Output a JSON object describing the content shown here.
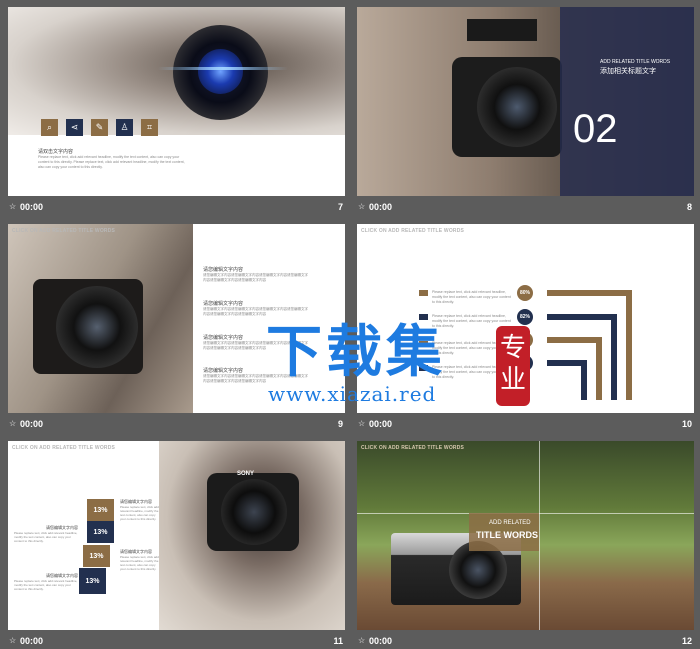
{
  "captions": [
    {
      "time": "00:00",
      "num": "7"
    },
    {
      "time": "00:00",
      "num": "8"
    },
    {
      "time": "00:00",
      "num": "9"
    },
    {
      "time": "00:00",
      "num": "10"
    },
    {
      "time": "00:00",
      "num": "11"
    },
    {
      "time": "00:00",
      "num": "12"
    }
  ],
  "star_icon": "☆",
  "slide7": {
    "heading": "请双击文字内容",
    "body": "Please replace text, click add relevant headline, modify the text content, also can copy your content to this directly. Please replace text, click add relevant headline, modify the text content, also can copy your content to this directly.",
    "icons": [
      "search-icon",
      "share-icon",
      "pencil-icon",
      "user-icon",
      "crop-icon"
    ]
  },
  "slide8": {
    "small_title": "ADD RELATED TITLE WORDS",
    "cn_title": "添加相关标题文字",
    "number": "02"
  },
  "slide9": {
    "title": "CLICK ON ADD RELATED TITLE WORDS",
    "blocks": [
      {
        "heading": "请您编辑文字内容",
        "body": "请您编辑文字内容请您编辑文字内容请您编辑文字内容请您编辑文字内容请您编辑文字内容请您编辑文字内容"
      },
      {
        "heading": "请您编辑文字内容",
        "body": "请您编辑文字内容请您编辑文字内容请您编辑文字内容请您编辑文字内容请您编辑文字内容请您编辑文字内容"
      },
      {
        "heading": "请您编辑文字内容",
        "body": "请您编辑文字内容请您编辑文字内容请您编辑文字内容请您编辑文字内容请您编辑文字内容请您编辑文字内容"
      },
      {
        "heading": "请您编辑文字内容",
        "body": "请您编辑文字内容请您编辑文字内容请您编辑文字内容请您编辑文字内容请您编辑文字内容请您编辑文字内容"
      }
    ]
  },
  "slide10": {
    "title": "CLICK ON ADD RELATED TITLE WORDS",
    "rows": [
      {
        "pct": "80%",
        "text": "Please replace text, click add relevant headline, modify the text content, also can copy your content to this directly."
      },
      {
        "pct": "82%",
        "text": "Please replace text, click add relevant headline, modify the text content, also can copy your content to this directly."
      },
      {
        "pct": "",
        "text": "Please replace text, click add relevant headline, modify the text content, also can copy your content to this directly."
      },
      {
        "pct": "",
        "text": "Please replace text, click add relevant headline, modify the text content, also can copy your content to this directly."
      }
    ],
    "gold": "#8c6d45",
    "navy": "#22304f"
  },
  "slide11": {
    "title": "CLICK ON ADD RELATED TITLE WORDS",
    "cubes": [
      "13%",
      "13%",
      "13%",
      "13%"
    ],
    "labels": [
      {
        "heading": "请您编辑文字内容",
        "body": "Please replace text, click add relevant headline, modify the text content, also can copy your content to this directly."
      },
      {
        "heading": "请您编辑文字内容",
        "body": "Please replace text, click add relevant headline, modify the text content, also can copy your content to this directly."
      },
      {
        "heading": "请您编辑文字内容",
        "body": "Please replace text, click add relevant headline, modify the text content, also can copy your content to this directly."
      },
      {
        "heading": "请您编辑文字内容",
        "body": "Please replace text, click add relevant headline, modify the text content, also can copy your content to this directly."
      }
    ],
    "camera_brand": "SONY"
  },
  "slide12": {
    "title": "CLICK ON ADD RELATED TITLE WORDS",
    "add": "ADD RELATED",
    "words": "TITLE WORDS"
  },
  "watermark": {
    "cn": "下载集",
    "seal": "专业",
    "url": "www.xiazai.red"
  }
}
